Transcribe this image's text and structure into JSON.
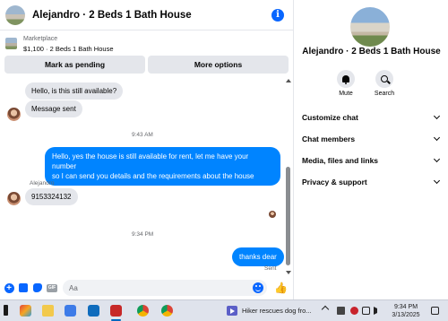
{
  "chat": {
    "title": "Alejandro · 2 Beds 1 Bath House",
    "listing": {
      "category": "Marketplace",
      "title": "$1,100 · 2 Beds 1 Bath House"
    },
    "actions": {
      "mark_pending": "Mark as pending",
      "more_options": "More options"
    },
    "messages": {
      "in1": "Hello, is this still available?",
      "in2": "Message sent",
      "time1": "9:43 AM",
      "out1_line1": "Hello, yes the house is still available for rent, let me have your number",
      "out1_line2": "so I can send you details and the requirements about the house",
      "sender": "Alejandro",
      "in3": "9153324132",
      "time2": "9:34 PM",
      "out2": "thanks dear",
      "status": "Sent"
    },
    "composer": {
      "placeholder": "Aa"
    }
  },
  "panel": {
    "name": "Alejandro · 2 Beds 1 Bath House",
    "mute_label": "Mute",
    "search_label": "Search",
    "sections": [
      "Customize chat",
      "Chat members",
      "Media, files and links",
      "Privacy & support"
    ]
  },
  "taskbar": {
    "news": "Hiker rescues dog fro...",
    "time": "9:34 PM",
    "date": "3/13/2025"
  },
  "colors": {
    "accent": "#0866ff",
    "bubble_out": "#0084ff",
    "bubble_in": "#e4e6eb"
  }
}
